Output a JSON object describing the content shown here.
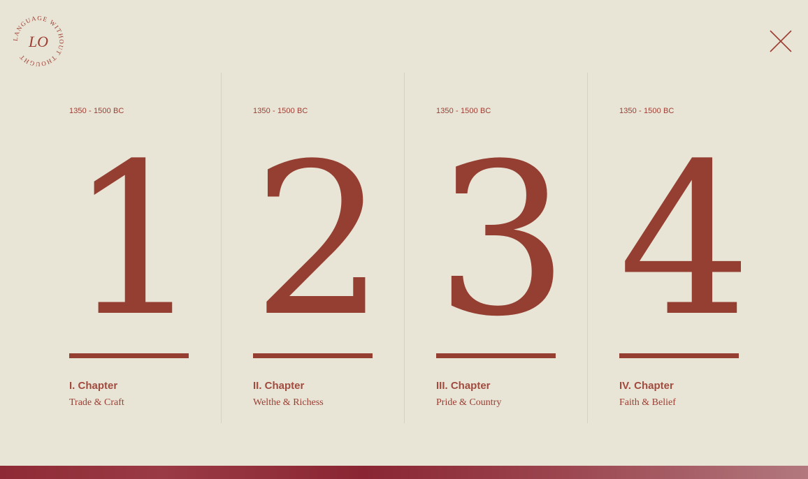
{
  "logo": {
    "monogram": "LO",
    "ring_text": "LANGUAGE WITHOUT THOUGHT",
    "icon": "circular-logo-icon"
  },
  "close": {
    "icon": "close-icon"
  },
  "chapters": [
    {
      "date": "1350 - 1500 BC",
      "numeral": "1",
      "title": "I. Chapter",
      "subtitle": "Trade & Craft"
    },
    {
      "date": "1350 - 1500 BC",
      "numeral": "2",
      "title": "II. Chapter",
      "subtitle": "Welthe & Richess"
    },
    {
      "date": "1350 - 1500 BC",
      "numeral": "3",
      "title": "III. Chapter",
      "subtitle": "Pride & Country"
    },
    {
      "date": "1350 - 1500 BC",
      "numeral": "4",
      "title": "IV. Chapter",
      "subtitle": "Faith & Belief"
    }
  ],
  "colors": {
    "background": "#e9e5d6",
    "accent": "#9b3d32",
    "divider": "#d6d1c0"
  }
}
